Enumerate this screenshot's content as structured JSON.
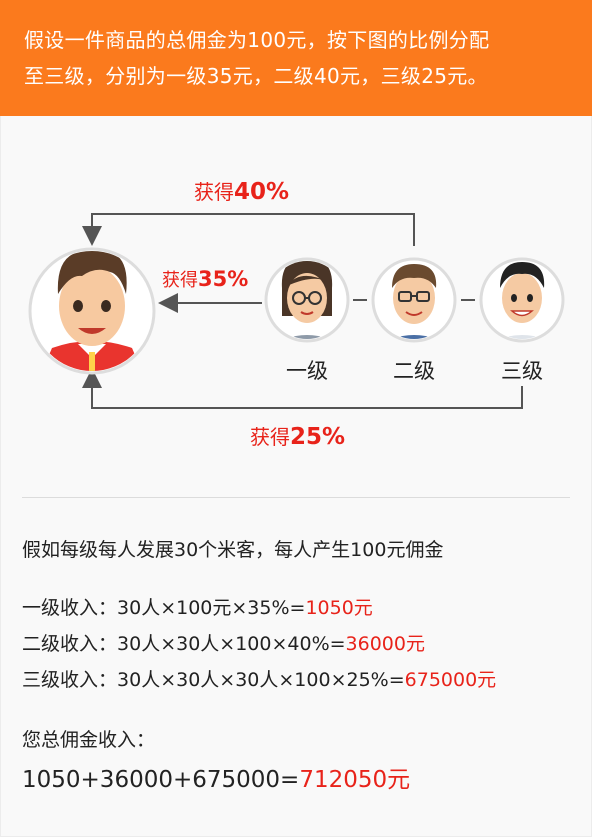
{
  "header": {
    "line1": "假设一件商品的总佣金为100元，按下图的比例分配",
    "line2": "至三级，分别为一级35元，二级40元，三级25元。"
  },
  "diagram": {
    "arrow_top": {
      "prefix": "获得",
      "value": "40%"
    },
    "arrow_mid": {
      "prefix": "获得",
      "value": "35%"
    },
    "arrow_bottom": {
      "prefix": "获得",
      "value": "25%"
    },
    "levels": [
      "一级",
      "二级",
      "三级"
    ]
  },
  "info": {
    "intro": "假如每级每人发展30个米客，每人产生100元佣金",
    "rows": [
      {
        "label": "一级收入：",
        "formula": "30人×100元×35%=",
        "result": "1050元"
      },
      {
        "label": "二级收入：",
        "formula": "30人×30人×100×40%=",
        "result": "36000元"
      },
      {
        "label": "三级收入：",
        "formula": "30人×30人×30人×100×25%=",
        "result": "675000元"
      }
    ],
    "total_label": "您总佣金收入：",
    "total_formula": "1050+36000+675000=",
    "total_result": "712050元"
  },
  "colors": {
    "header_bg": "#fb7a1d",
    "accent_red": "#e8231a",
    "arrow_gray": "#555555",
    "avatar_border": "#dddddd"
  }
}
